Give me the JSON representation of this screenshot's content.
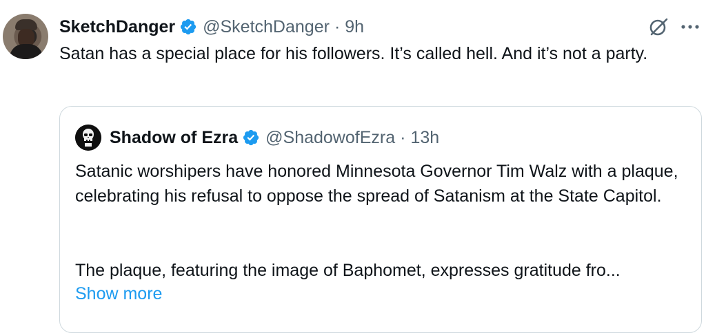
{
  "post": {
    "author_name": "SketchDanger",
    "author_handle": "@SketchDanger",
    "time": "9h",
    "separator": "·",
    "text": "Satan has a special place for his followers.  It’s called hell. And it’s not a party."
  },
  "quote": {
    "author_name": "Shadow of Ezra",
    "author_handle": "@ShadowofEzra",
    "time": "13h",
    "separator": "·",
    "paragraph1": "Satanic worshipers have honored Minnesota Governor Tim Walz with a plaque, celebrating his refusal to oppose the spread of Satanism at the State Capitol.",
    "paragraph2": "The plaque, featuring the image of Baphomet, expresses gratitude fro...",
    "show_more": "Show more"
  },
  "icons": {
    "verified": "verified-badge-icon",
    "grok": "grok-icon",
    "more": "more-options-icon"
  },
  "colors": {
    "verified": "#1d9bf0",
    "link": "#1d9bf0",
    "secondary_text": "#536471",
    "border": "#cfd9de"
  }
}
